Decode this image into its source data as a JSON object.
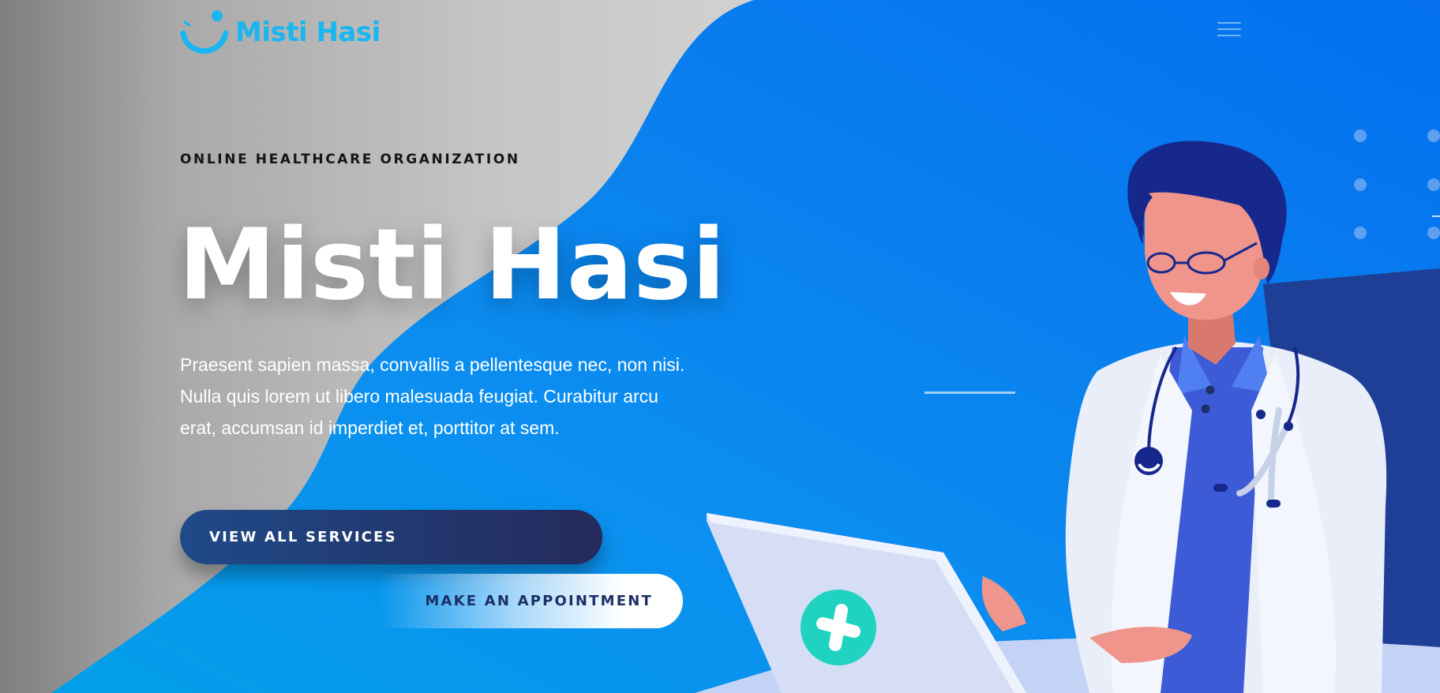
{
  "brand": {
    "name": "Misti Hasi",
    "logo_icon": "smile-logo-icon",
    "color": "#19b6f0"
  },
  "nav": {
    "menu_icon": "hamburger-menu-icon"
  },
  "hero": {
    "eyebrow": "ONLINE HEALTHCARE ORGANIZATION",
    "title": "Misti Hasi",
    "intro": "Praesent sapien massa, convallis a pellentesque nec, non nisi. Nulla quis lorem ut libero malesuada feugiat. Curabitur arcu erat, accumsan id imperdiet et, porttitor at sem.",
    "primary_button": "VIEW ALL SERVICES",
    "secondary_button": "MAKE AN APPOINTMENT",
    "illustration": "doctor-with-laptop-illustration"
  },
  "colors": {
    "accent_blue": "#0a7df0",
    "deep_blue": "#1f4a88",
    "navy": "#242a5c",
    "light_gray": "#c6c6c6",
    "white": "#ffffff"
  }
}
